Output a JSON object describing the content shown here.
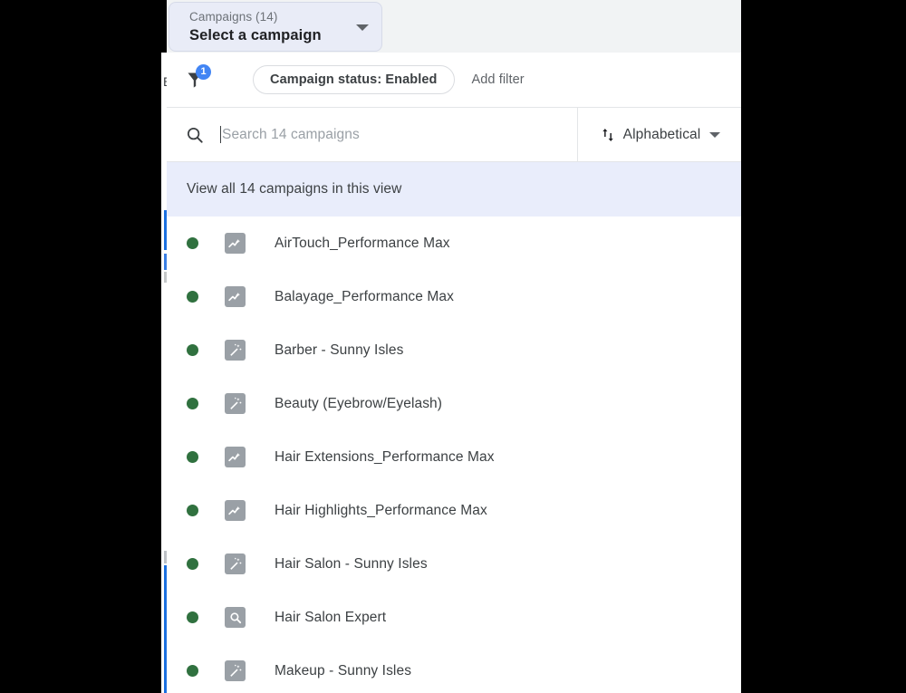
{
  "colors": {
    "accent_blue": "#4285f4",
    "status_green": "#30713f",
    "selector_bg": "#e9ecf7",
    "header_band": "#f1f3f4",
    "view_all_bg": "#e9edfb",
    "icon_gray": "#9aa0a6",
    "text_primary": "#3c4043",
    "text_secondary": "#5f6368",
    "placeholder": "#9aa0a6",
    "sidebar_selection": "#1a6fe0"
  },
  "selector": {
    "sub_label": "Campaigns (14)",
    "main_label": "Select a campaign",
    "caret_icon": "chevron-down-icon"
  },
  "filter_bar": {
    "filter_icon": "filter-funnel-icon",
    "filter_count_badge": "1",
    "active_chip": "Campaign status: Enabled",
    "add_filter_label": "Add filter"
  },
  "search": {
    "search_icon": "search-icon",
    "placeholder": "Search 14 campaigns",
    "value": "",
    "cursor_visible": true
  },
  "sort": {
    "sort_icon": "sort-arrows-icon",
    "selected": "Alphabetical",
    "caret_icon": "chevron-down-icon"
  },
  "view_all": {
    "label": "View all 14 campaigns in this view"
  },
  "sliver": {
    "partial_glyph": "E"
  },
  "campaigns": [
    {
      "name": "AirTouch_Performance Max",
      "status": "enabled",
      "status_icon": "status-dot-enabled",
      "type_icon": "performance-max-icon"
    },
    {
      "name": "Balayage_Performance Max",
      "status": "enabled",
      "status_icon": "status-dot-enabled",
      "type_icon": "performance-max-icon"
    },
    {
      "name": "Barber - Sunny Isles",
      "status": "enabled",
      "status_icon": "status-dot-enabled",
      "type_icon": "smart-campaign-icon"
    },
    {
      "name": "Beauty (Eyebrow/Eyelash)",
      "status": "enabled",
      "status_icon": "status-dot-enabled",
      "type_icon": "smart-campaign-icon"
    },
    {
      "name": "Hair Extensions_Performance Max",
      "status": "enabled",
      "status_icon": "status-dot-enabled",
      "type_icon": "performance-max-icon"
    },
    {
      "name": "Hair Highlights_Performance Max",
      "status": "enabled",
      "status_icon": "status-dot-enabled",
      "type_icon": "performance-max-icon"
    },
    {
      "name": "Hair Salon - Sunny Isles",
      "status": "enabled",
      "status_icon": "status-dot-enabled",
      "type_icon": "smart-campaign-icon"
    },
    {
      "name": "Hair Salon Expert",
      "status": "enabled",
      "status_icon": "status-dot-enabled",
      "type_icon": "search-campaign-icon"
    },
    {
      "name": "Makeup - Sunny Isles",
      "status": "enabled",
      "status_icon": "status-dot-enabled",
      "type_icon": "smart-campaign-icon"
    }
  ]
}
